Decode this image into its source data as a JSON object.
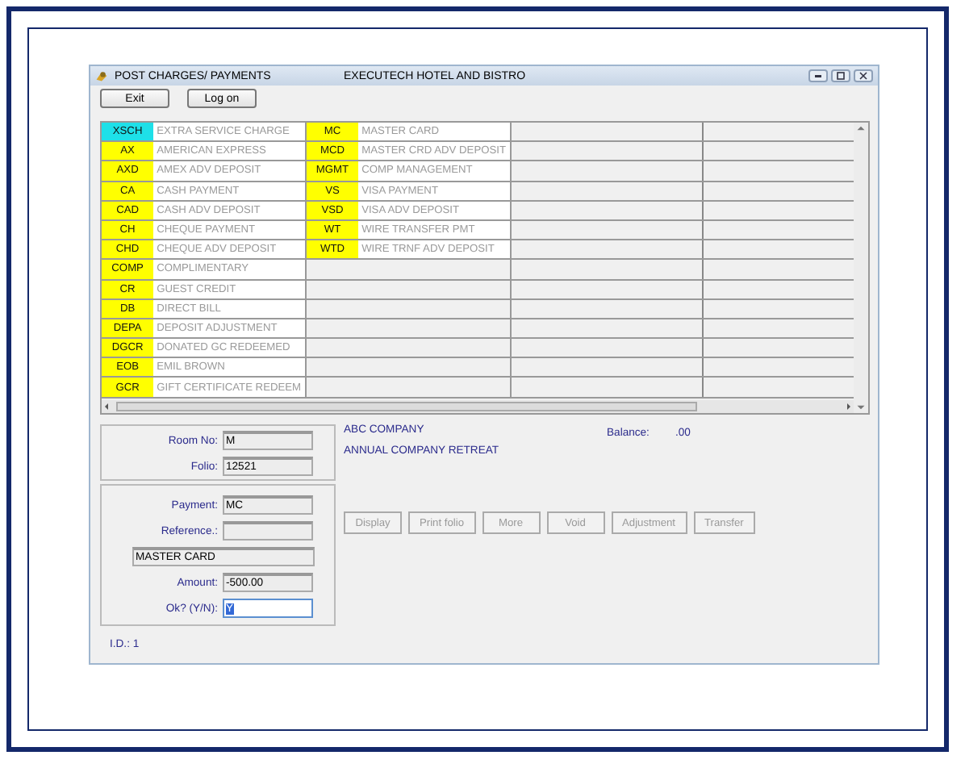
{
  "window": {
    "title": "POST CHARGES/ PAYMENTS",
    "subtitle": "EXECUTECH HOTEL AND BISTRO"
  },
  "toolbar": [
    "Exit",
    "Log on"
  ],
  "grid": {
    "columns": [
      [
        {
          "code": "XSCH",
          "description": "EXTRA SERVICE CHARGE",
          "selected": true
        },
        {
          "code": "AX",
          "description": "AMERICAN EXPRESS",
          "selected": false
        },
        {
          "code": "AXD",
          "description": "AMEX ADV DEPOSIT",
          "selected": false
        },
        {
          "code": "CA",
          "description": "CASH PAYMENT",
          "selected": false
        },
        {
          "code": "CAD",
          "description": "CASH ADV DEPOSIT",
          "selected": false
        },
        {
          "code": "CH",
          "description": "CHEQUE PAYMENT",
          "selected": false
        },
        {
          "code": "CHD",
          "description": "CHEQUE ADV DEPOSIT",
          "selected": false
        },
        {
          "code": "COMP",
          "description": "COMPLIMENTARY",
          "selected": false
        },
        {
          "code": "CR",
          "description": "GUEST CREDIT",
          "selected": false
        },
        {
          "code": "DB",
          "description": "DIRECT BILL",
          "selected": false
        },
        {
          "code": "DEPA",
          "description": "DEPOSIT ADJUSTMENT",
          "selected": false
        },
        {
          "code": "DGCR",
          "description": "DONATED GC REDEEMED",
          "selected": false
        },
        {
          "code": "EOB",
          "description": "EMIL BROWN",
          "selected": false
        },
        {
          "code": "GCR",
          "description": "GIFT CERTIFICATE REDEEM",
          "selected": false
        }
      ],
      [
        {
          "code": "MC",
          "description": "MASTER CARD",
          "selected": false
        },
        {
          "code": "MCD",
          "description": "MASTER CRD ADV DEPOSIT",
          "selected": false
        },
        {
          "code": "MGMT",
          "description": "COMP MANAGEMENT",
          "selected": false
        },
        {
          "code": "VS",
          "description": "VISA PAYMENT",
          "selected": false
        },
        {
          "code": "VSD",
          "description": "VISA ADV DEPOSIT",
          "selected": false
        },
        {
          "code": "WT",
          "description": "WIRE TRANSFER PMT",
          "selected": false
        },
        {
          "code": "WTD",
          "description": "WIRE TRNF ADV DEPOSIT",
          "selected": false
        }
      ]
    ]
  },
  "room": {
    "room_no_label": "Room No:",
    "room_no": "M",
    "folio_label": "Folio:",
    "folio": "12521"
  },
  "payment": {
    "payment_label": "Payment:",
    "payment": "MC",
    "reference_label": "Reference.:",
    "description": "MASTER CARD",
    "amount_label": "Amount:",
    "amount": "-500.00",
    "ok_label": "Ok? (Y/N):",
    "ok": "Y"
  },
  "guest": {
    "company": "ABC COMPANY",
    "group": "ANNUAL COMPANY RETREAT",
    "balance_label": "Balance:",
    "balance": ".00"
  },
  "actions": [
    {
      "label": "Display",
      "disabled": true
    },
    {
      "label": "Print folio",
      "disabled": true
    },
    {
      "label": "More",
      "disabled": true
    },
    {
      "label": "Void",
      "disabled": true
    },
    {
      "label": "Adjustment",
      "disabled": true
    },
    {
      "label": "Transfer",
      "disabled": true
    }
  ],
  "status": "I.D.: 1"
}
